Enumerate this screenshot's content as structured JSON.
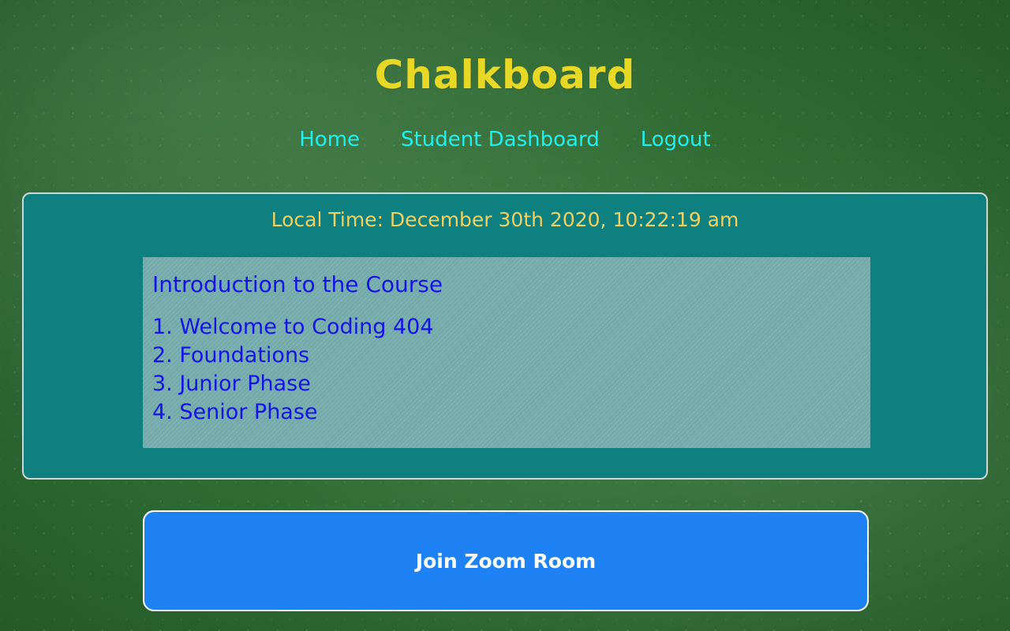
{
  "app": {
    "title": "Chalkboard"
  },
  "nav": {
    "items": [
      {
        "label": "Home"
      },
      {
        "label": "Student Dashboard"
      },
      {
        "label": "Logout"
      }
    ]
  },
  "main": {
    "local_time": "Local Time: December 30th 2020, 10:22:19 am",
    "course": {
      "title": "Introduction to the Course",
      "items": [
        {
          "label": "1. Welcome to Coding 404"
        },
        {
          "label": "2. Foundations"
        },
        {
          "label": "3. Junior Phase"
        },
        {
          "label": "4. Senior Phase"
        }
      ]
    }
  },
  "actions": {
    "join_zoom_label": "Join Zoom Room"
  },
  "colors": {
    "background": "#2f6a33",
    "title": "#e8d826",
    "nav_link": "#1ef0f0",
    "card": "#0e8080",
    "local_time": "#f0d060",
    "course_panel": "#76adad",
    "course_text": "#1414e6",
    "zoom_button": "#1e82f5"
  }
}
